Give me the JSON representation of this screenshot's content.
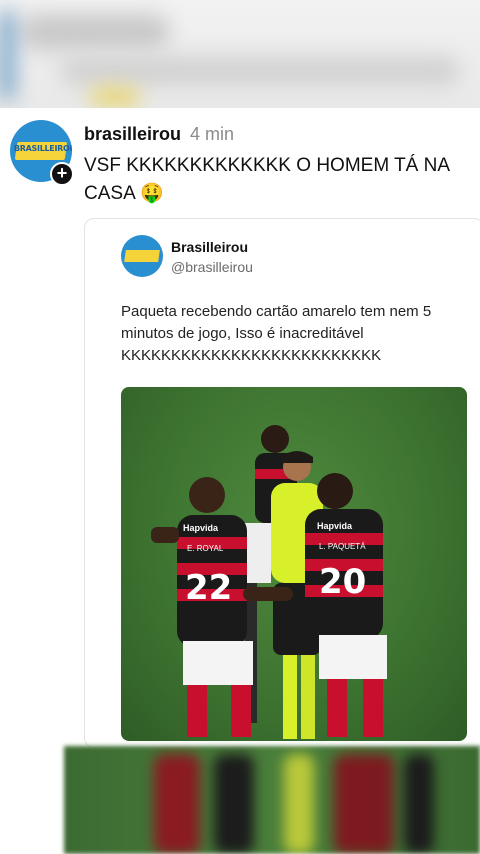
{
  "post": {
    "username": "brasilleirou",
    "time": "4 min",
    "text": "VSF KKKKKKKKKKKKK O HOMEM TÁ NA CASA 🤑",
    "avatar_logo_text": "BRASILLEIROU",
    "follow_icon": "plus-icon"
  },
  "quote": {
    "name": "Brasilleirou",
    "handle": "@brasilleirou",
    "text": "Paqueta recebendo cartão amarelo tem nem 5 minutos de jogo, Isso é inacreditável KKKKKKKKKKKKKKKKKKKKKKKKKK",
    "photo": {
      "player_left": {
        "name": "E. ROYAL",
        "number": "22",
        "sponsor": "Hapvida"
      },
      "player_right": {
        "name": "L. PAQUETÁ",
        "number": "20",
        "sponsor": "Hapvida"
      }
    }
  },
  "colors": {
    "accent_blue": "#2a8fd0",
    "logo_yellow": "#f5d33b",
    "kit_red": "#c8102e",
    "kit_black": "#1a1a1a",
    "referee_yellow": "#d7f02a",
    "pitch_green": "#3c7230"
  }
}
